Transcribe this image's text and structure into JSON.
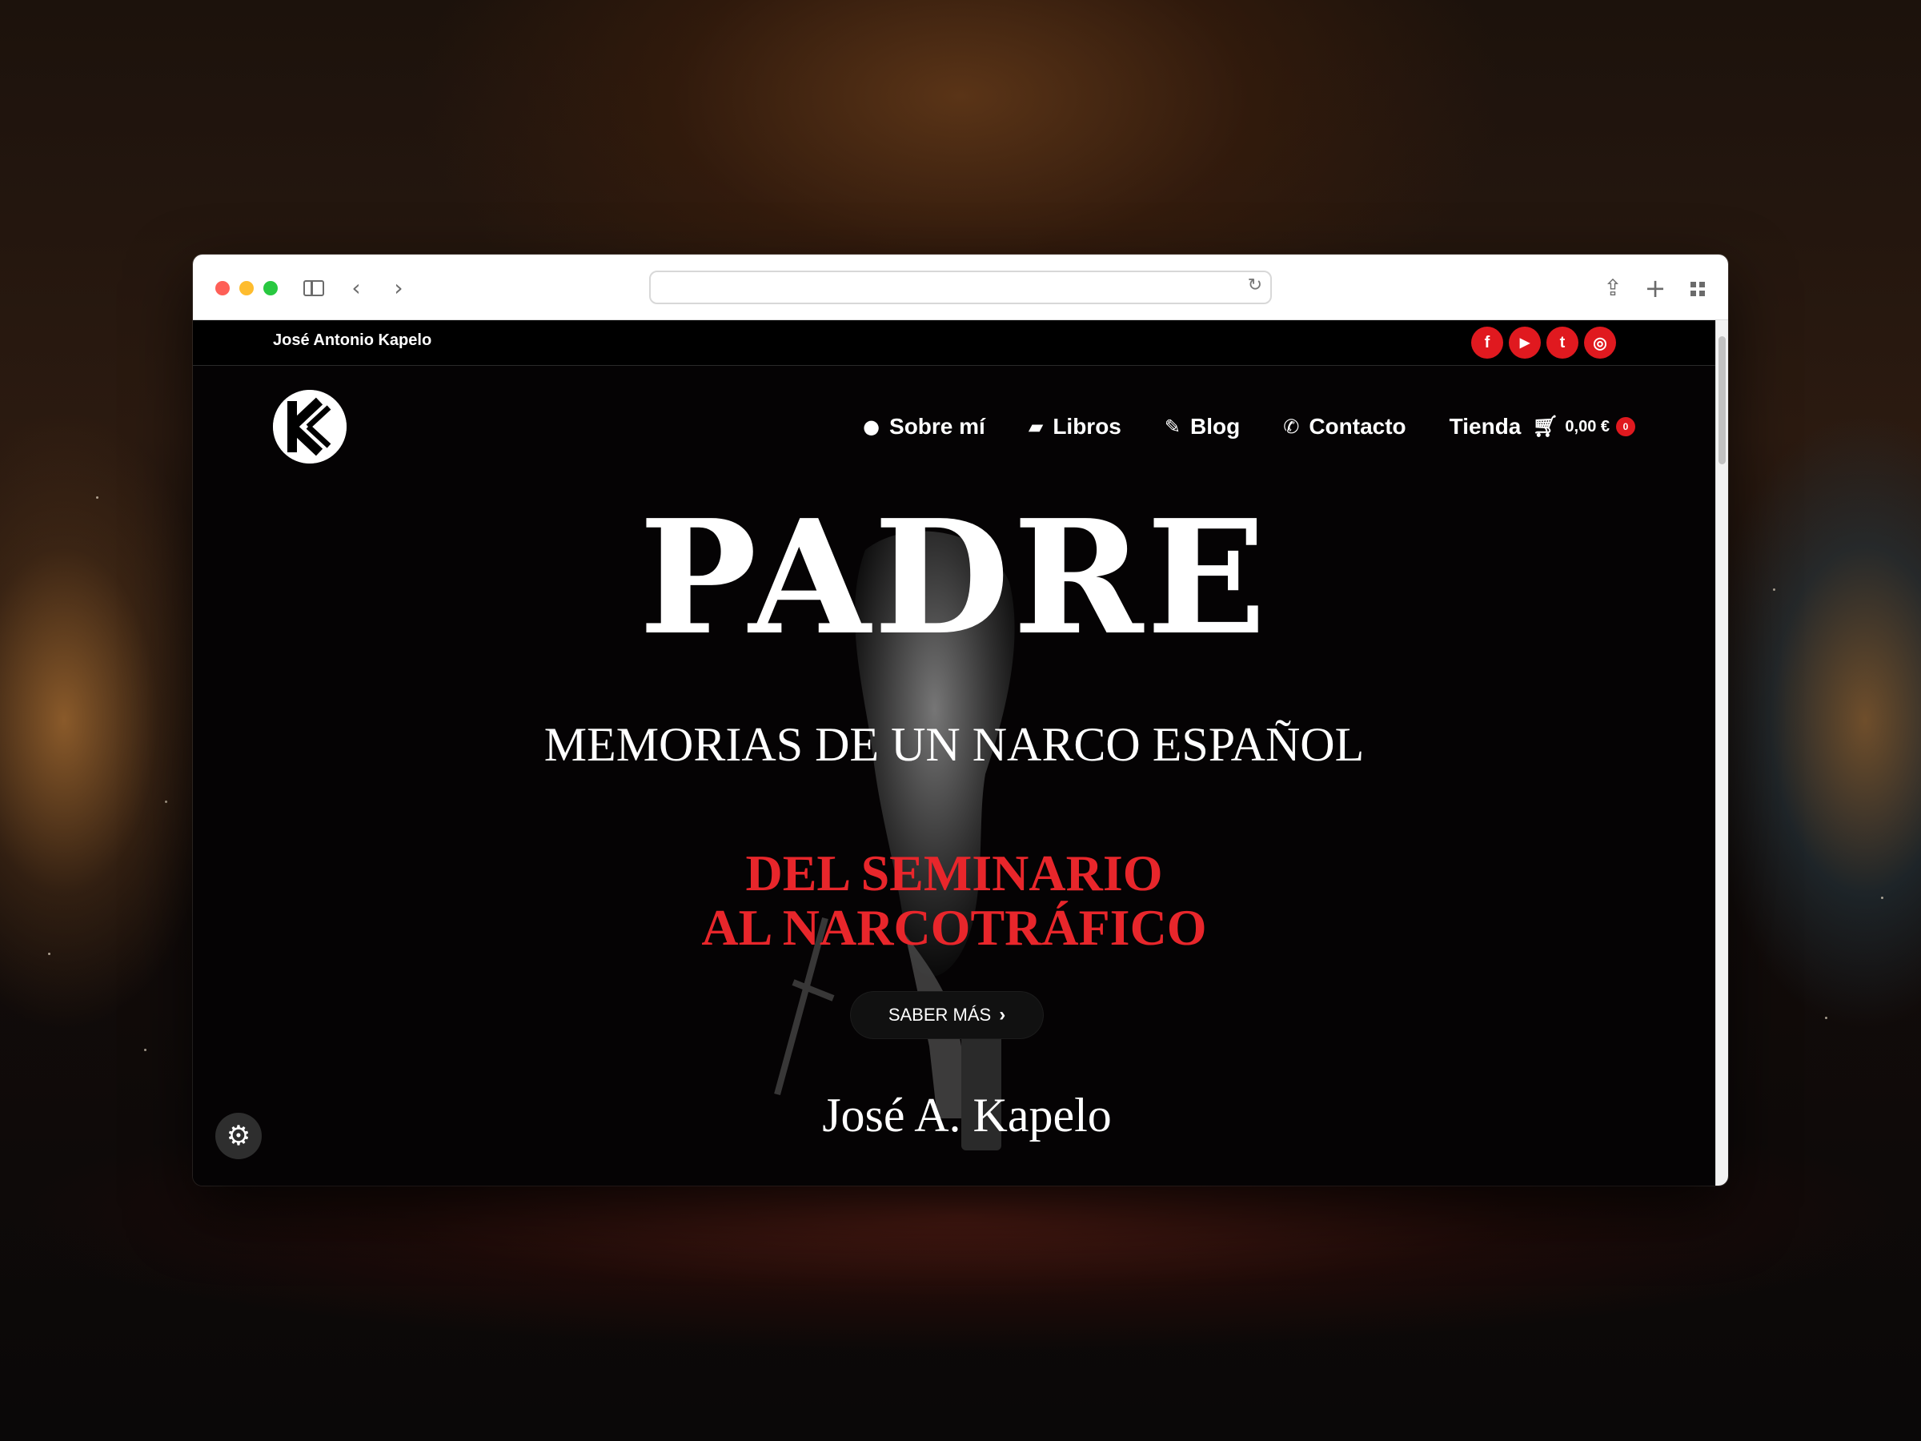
{
  "browser": {
    "url": ""
  },
  "site": {
    "owner_name": "José Antonio Kapelo",
    "social_links": [
      {
        "icon": "facebook-icon",
        "glyph": "f"
      },
      {
        "icon": "youtube-icon",
        "glyph": "▶"
      },
      {
        "icon": "twitter-icon",
        "glyph": "t"
      },
      {
        "icon": "instagram-icon",
        "glyph": "◎"
      }
    ],
    "accent_color": "#e0191f"
  },
  "nav": {
    "items": [
      {
        "label": "Sobre mí",
        "icon": "user-icon"
      },
      {
        "label": "Libros",
        "icon": "book-icon"
      },
      {
        "label": "Blog",
        "icon": "pencil-icon"
      },
      {
        "label": "Contacto",
        "icon": "phone-icon"
      },
      {
        "label": "Tienda",
        "icon": ""
      }
    ],
    "cart": {
      "total": "0,00 €",
      "count": "0"
    }
  },
  "hero": {
    "title": "PADRE",
    "subtitle": "MEMORIAS DE UN NARCO ESPAÑOL",
    "tagline_line1": "DEL SEMINARIO",
    "tagline_line2": "AL NARCOTRÁFICO",
    "cta_label": "SABER MÁS",
    "author": "José A. Kapelo"
  }
}
